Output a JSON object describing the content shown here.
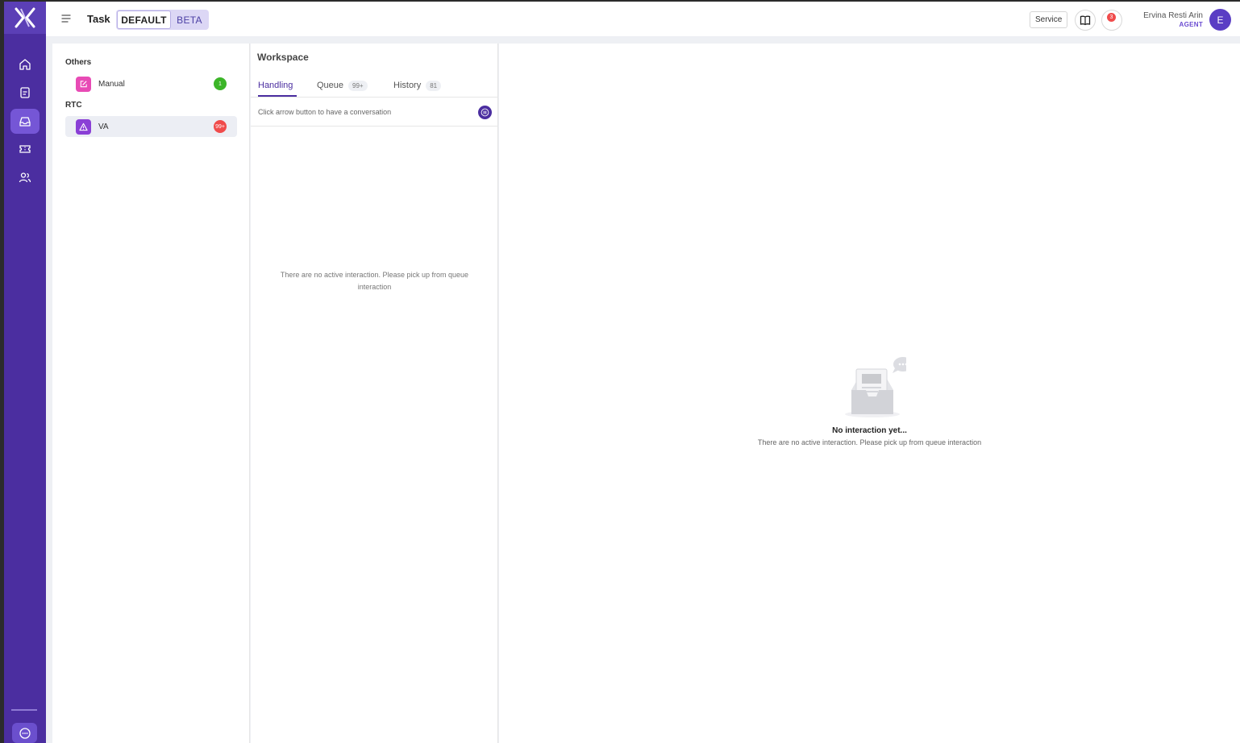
{
  "header": {
    "page_title": "Task",
    "mode_default": "DEFAULT",
    "mode_beta": "BETA",
    "service_label": "Service",
    "notification_count": "3",
    "user_name": "Ervina Resti Arin",
    "user_role": "AGENT",
    "avatar_initial": "E"
  },
  "rail": {
    "items": [
      {
        "icon": "home-icon"
      },
      {
        "icon": "document-icon"
      },
      {
        "icon": "inbox-icon",
        "active": true
      },
      {
        "icon": "ticket-icon"
      },
      {
        "icon": "users-icon"
      }
    ],
    "bottom_icon": "chat-icon"
  },
  "channels": {
    "sections": [
      {
        "label": "Others",
        "items": [
          {
            "label": "Manual",
            "count": "1",
            "icon": "edit-icon",
            "icon_color": "#e84bb5",
            "count_color": "#3cb528"
          }
        ]
      },
      {
        "label": "RTC",
        "items": [
          {
            "label": "VA",
            "count": "99+",
            "icon": "warning-icon",
            "icon_color": "#8a3fd6",
            "count_color": "#f04b4b"
          }
        ]
      }
    ]
  },
  "workspace": {
    "title": "Workspace",
    "tabs": [
      {
        "label": "Handling",
        "count": ""
      },
      {
        "label": "Queue",
        "count": "99+"
      },
      {
        "label": "History",
        "count": "81"
      }
    ],
    "hint": "Click arrow button to have a conversation",
    "empty_text": "There are no active interaction. Please pick up from queue interaction"
  },
  "detail": {
    "empty_title": "No interaction yet...",
    "empty_subtitle": "There are no active interaction. Please pick up from queue interaction"
  },
  "colors": {
    "brand": "#4b2ea0",
    "accent": "#6a4bd1"
  }
}
